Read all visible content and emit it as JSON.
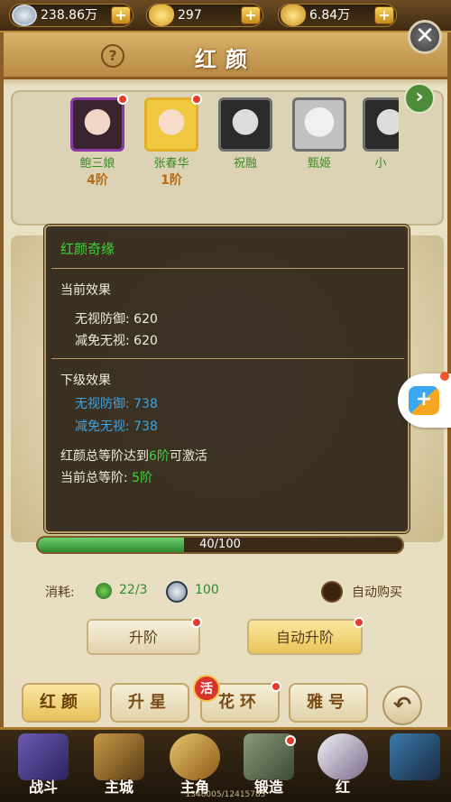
{
  "currencies": [
    {
      "icon": "silver-coin-icon",
      "value": "238.86万"
    },
    {
      "icon": "gold-ingot-icon",
      "value": "297"
    },
    {
      "icon": "treasure-ingot-icon",
      "value": "6.84万"
    }
  ],
  "panel": {
    "title": "红颜",
    "help": "?",
    "close": "✕"
  },
  "heroes": [
    {
      "name": "鲍三娘",
      "stage": "4阶",
      "has_dot": true
    },
    {
      "name": "张春华",
      "stage": "1阶",
      "has_dot": true
    },
    {
      "name": "祝融",
      "stage": "",
      "has_dot": false
    },
    {
      "name": "甄姬",
      "stage": "",
      "has_dot": false
    },
    {
      "name": "小",
      "stage": "",
      "has_dot": false
    }
  ],
  "tooltip": {
    "title": "红颜奇缘",
    "current_header": "当前效果",
    "current": [
      {
        "label": "无视防御:",
        "value": "620"
      },
      {
        "label": "减免无视:",
        "value": "620"
      }
    ],
    "next_header": "下级效果",
    "next": [
      {
        "label": "无视防御:",
        "value": "738"
      },
      {
        "label": "减免无视:",
        "value": "738"
      }
    ],
    "activate_pre": "红颜总等阶达到",
    "activate_val": "6阶",
    "activate_post": "可激活",
    "total_label": "当前总等阶:",
    "total_value": "5阶"
  },
  "progress": {
    "text": "40/100",
    "fraction": 0.4
  },
  "cost": {
    "label": "消耗:",
    "item1": "22/3",
    "item2": "100",
    "auto_buy": "自动购买"
  },
  "buttons": {
    "upgrade": "升阶",
    "auto_upgrade": "自动升阶"
  },
  "tabs": [
    "红颜",
    "升星",
    "花环",
    "雅号"
  ],
  "tab_badge": "活",
  "bottom_nav": [
    "战斗",
    "主城",
    "主角",
    "锻造",
    "红"
  ],
  "footer": "1348005/12415785",
  "colors": {
    "positive": "#3fd33a",
    "next_effect": "#3aa3e6",
    "tooltip_bg": "#30261a"
  }
}
